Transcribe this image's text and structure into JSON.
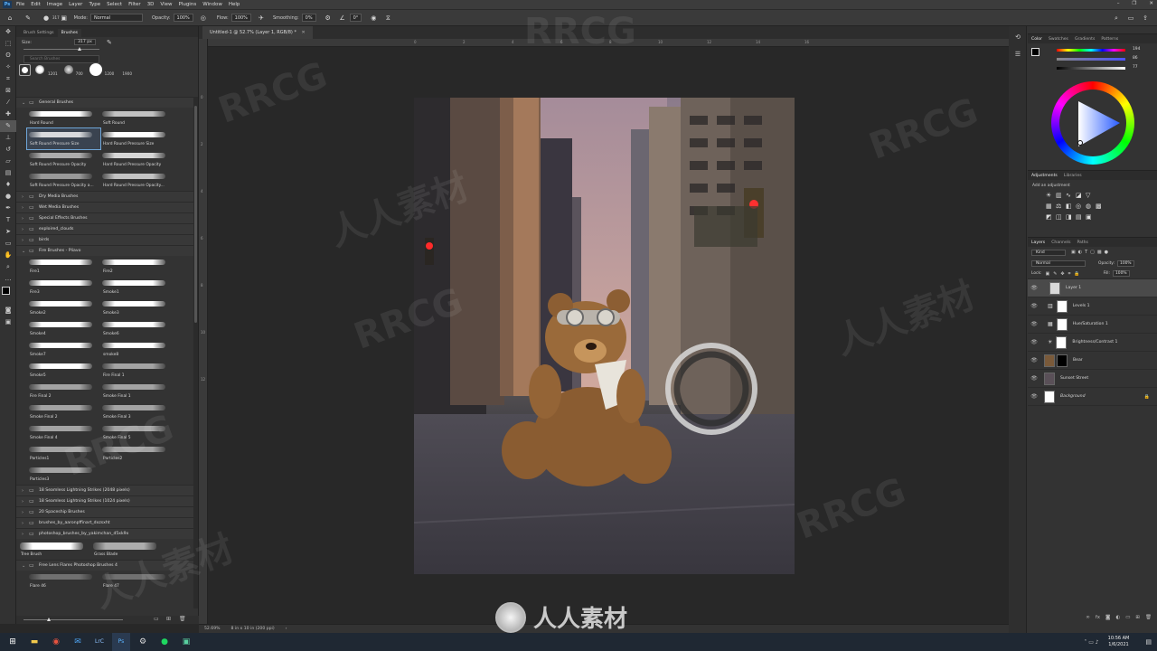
{
  "menu": [
    "File",
    "Edit",
    "Image",
    "Layer",
    "Type",
    "Select",
    "Filter",
    "3D",
    "View",
    "Plugins",
    "Window",
    "Help"
  ],
  "options_bar": {
    "brush_size": "317",
    "mode_label": "Mode:",
    "mode_value": "Normal",
    "opacity_label": "Opacity:",
    "opacity_value": "100%",
    "flow_label": "Flow:",
    "flow_value": "100%",
    "smoothing_label": "Smoothing:",
    "smoothing_value": "0%",
    "angle_value": "0°"
  },
  "left_panel": {
    "tabs": [
      "Brush Settings",
      "Brushes"
    ],
    "size_label": "Size:",
    "size_value": "317 px",
    "search_placeholder": "Search Brushes",
    "presets": [
      "1201",
      "700",
      "1200",
      "1900"
    ],
    "group_general": "General Brushes",
    "general_brushes": [
      "Hard Round",
      "Soft Round",
      "Soft Round Pressure Size",
      "Hard Round Pressure Size",
      "Soft Round Pressure Opacity",
      "Hard Round Pressure Opacity",
      "Soft Round Pressure Opacity a...",
      "Hard Round Pressure Opacity..."
    ],
    "groups_mid": [
      "Dry Media Brushes",
      "Wet Media Brushes",
      "Special Effects Brushes",
      "exploired_clouds",
      "birds",
      "Fire Brushes - Pliavo"
    ],
    "fire_brushes": [
      "Fire1",
      "Fire2",
      "Fire3",
      "Smoke1",
      "Smoke2",
      "Smoke3",
      "Smoke4",
      "Smoke6",
      "Smoke7",
      "smoke8",
      "Smoke5",
      "Fire Final 1",
      "Fire Final 2",
      "Smoke Final 1",
      "Smoke Final 2",
      "Smoke Final 3",
      "Smoke Final 4",
      "Smoke Final 5",
      "Particles1",
      "Particles2",
      "Particles3"
    ],
    "groups_bottom": [
      "18 Seamless Lightning Strikes (2048 pixels)",
      "18 Seamless Lightning Strikes (1024 pixels)",
      "20 Spaceship Brushes",
      "brushes_by_aaronpffinart_dxzsxht",
      "photoshop_brushes_by_yakimchan_d5xk9x"
    ],
    "tree_brushes": [
      "Tree Brush",
      "Grass Blade"
    ],
    "group_flares": "Free Lens Flares Photoshop Brushes 4",
    "flare_brushes": [
      "Flare 46",
      "Flare 47"
    ]
  },
  "document": {
    "tab_title": "Untitled-1 @ 52.7% (Layer 1, RGB/8) *",
    "ruler_top": [
      "0",
      "2",
      "4",
      "6",
      "8",
      "10",
      "12",
      "14",
      "16"
    ],
    "ruler_left": [
      "0",
      "2",
      "4",
      "6",
      "8",
      "10",
      "12"
    ],
    "zoom": "52.69%",
    "doc_info": "8 in x 10 in (200 ppi)"
  },
  "color_panel": {
    "tabs": [
      "Color",
      "Swatches",
      "Gradients",
      "Patterns"
    ],
    "values": [
      "194",
      "86",
      "77"
    ]
  },
  "adjustments_panel": {
    "tabs": [
      "Adjustments",
      "Libraries"
    ],
    "add_label": "Add an adjustment"
  },
  "layers_panel": {
    "tabs": [
      "Layers",
      "Channels",
      "Paths"
    ],
    "filter_kind": "Kind",
    "blend_mode": "Normal",
    "opacity_label": "Opacity:",
    "opacity_value": "100%",
    "lock_label": "Lock:",
    "fill_label": "Fill:",
    "fill_value": "100%",
    "layers": [
      "Layer 1",
      "Levels 1",
      "Hue/Saturation 1",
      "Brightness/Contrast 1",
      "Bear",
      "Sunset Street",
      "Background"
    ]
  },
  "taskbar": {
    "time": "10:56 AM",
    "date": "1/6/2021"
  },
  "watermark": {
    "text_latin": "RRCG",
    "text_cn": "人人素材"
  },
  "colors": {
    "accent_selection": "#6fa6d8",
    "panel": "#333333",
    "pasteboard": "#282828"
  }
}
